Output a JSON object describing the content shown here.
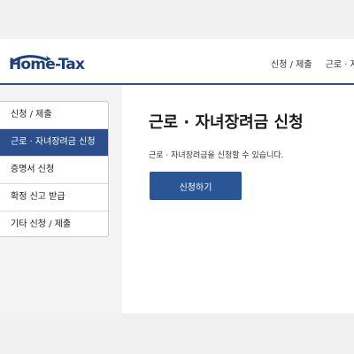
{
  "header": {
    "logo_text": "Home-Tax",
    "nav": [
      "신청 / 제출",
      "근로 · 자녀장려금 신청"
    ]
  },
  "sidebar": {
    "items": [
      {
        "label": "신청 / 제출",
        "active": false
      },
      {
        "label": "근로 · 자녀장려금 신청",
        "active": true
      },
      {
        "label": "증명서 신청",
        "active": false
      },
      {
        "label": "확정 신고 받급",
        "active": false
      },
      {
        "label": "기타 신청 / 제출",
        "active": false
      }
    ]
  },
  "main": {
    "title": "근로 · 자녀장려금 신청",
    "description": "근로 · 자녀장려금을 신청할 수 있습니다.",
    "button_label": "신청하기"
  },
  "colors": {
    "accent": "#2a4f8c",
    "button": "#2a5596"
  }
}
